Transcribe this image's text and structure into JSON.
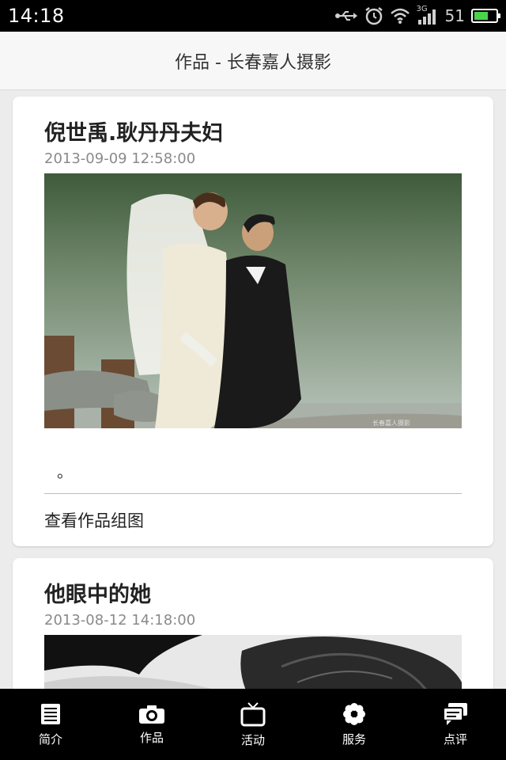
{
  "status_bar": {
    "time": "14:18",
    "network": "3G",
    "signal_strength": "51",
    "icons": [
      "usb-icon",
      "alarm-icon",
      "wifi-icon",
      "signal-icon",
      "battery-icon"
    ]
  },
  "header": {
    "title": "作品 - 长春嘉人摄影"
  },
  "posts": [
    {
      "title": "倪世禹.耿丹丹夫妇",
      "date": "2013-09-09 12:58:00",
      "image_desc": "wedding-couple-lakeside",
      "excerpt": "。",
      "more_link": "查看作品组图"
    },
    {
      "title": "他眼中的她",
      "date": "2013-08-12 14:18:00",
      "image_desc": "black-white-portrait"
    }
  ],
  "tabbar": {
    "items": [
      {
        "label": "简介",
        "icon": "document-icon"
      },
      {
        "label": "作品",
        "icon": "camera-icon"
      },
      {
        "label": "活动",
        "icon": "tv-icon"
      },
      {
        "label": "服务",
        "icon": "flower-icon"
      },
      {
        "label": "点评",
        "icon": "chat-icon"
      }
    ]
  },
  "colors": {
    "status_bar_bg": "#000000",
    "header_bg": "#f7f7f7",
    "page_bg": "#ececec",
    "card_bg": "#ffffff",
    "tabbar_bg": "#000000"
  }
}
